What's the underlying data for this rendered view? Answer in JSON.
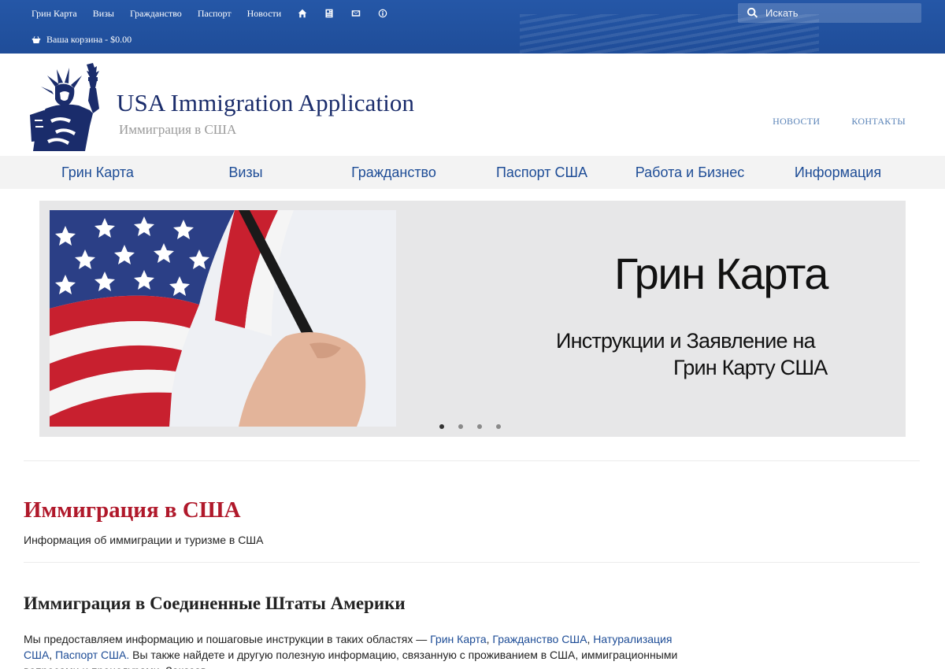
{
  "topbar": {
    "nav": [
      "Грин Карта",
      "Визы",
      "Гражданство",
      "Паспорт",
      "Новости"
    ],
    "icons": [
      "home-icon",
      "document-icon",
      "mail-icon",
      "info-icon"
    ],
    "cart_label": "Ваша корзина - $0.00",
    "search_placeholder": "Искать",
    "color": "#2557a7"
  },
  "header": {
    "title": "USA Immigration Application",
    "subtitle": "Иммиграция в США",
    "links": [
      "НОВОСТИ",
      "КОНТАКТЫ"
    ]
  },
  "mainnav": {
    "items": [
      "Грин Карта",
      "Визы",
      "Гражданство",
      "Паспорт США",
      "Работа и Бизнес",
      "Информация"
    ]
  },
  "slider": {
    "title": "Грин Карта",
    "line1": "Инструкции и Заявление на",
    "line2": "Грин Карту США",
    "dots": 4,
    "active_dot": 1
  },
  "content": {
    "title": "Иммиграция в США",
    "subtitle": "Информация об иммиграции и туризме в США",
    "section_title": "Иммиграция в Соединенные Штаты Америки",
    "para_intro": "Мы предоставляем информацию и пошаговые инструкции в таких областях — ",
    "para_links": [
      "Грин Карта",
      "Гражданство США",
      "Натурализация США",
      "Паспорт США."
    ],
    "para_rest": " Вы также найдете и другую полезную информацию, связанную с проживанием в США, иммиграционными вопросами и процедурами. Заказав"
  },
  "colors": {
    "accent": "#1d4c96",
    "title_red": "#b0192b",
    "logo_navy": "#1a2c6b"
  }
}
